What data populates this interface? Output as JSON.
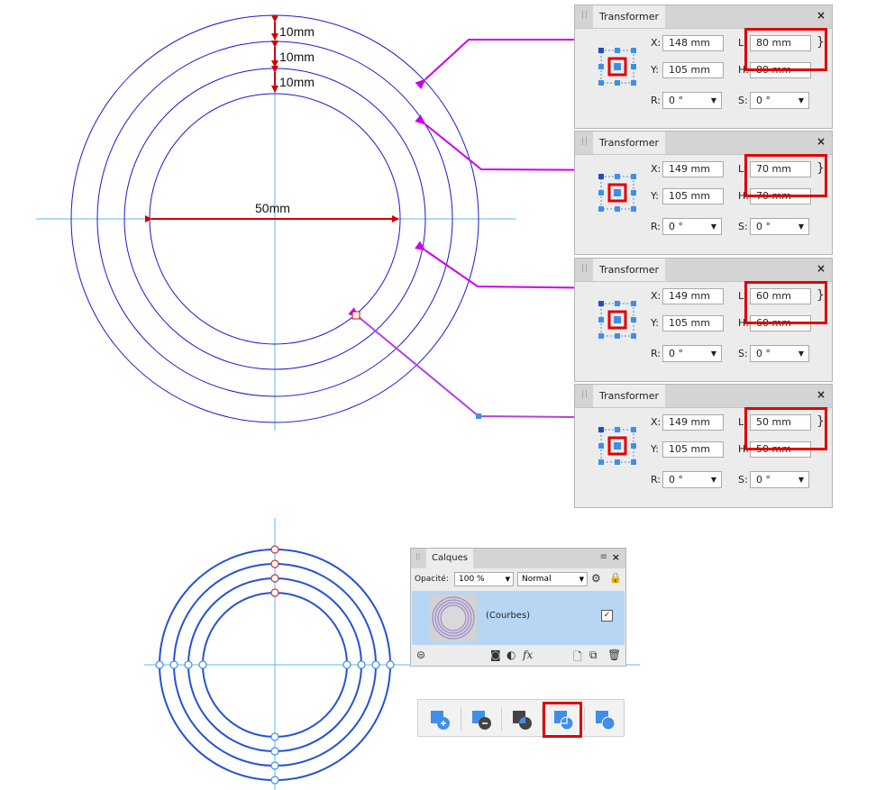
{
  "dimensions": {
    "ring_spacing": [
      "10mm",
      "10mm",
      "10mm"
    ],
    "inner_diameter": "50mm"
  },
  "transformer_panels": [
    {
      "title": "Transformer",
      "x_label": "X:",
      "x": "148 mm",
      "y_label": "Y:",
      "y": "105 mm",
      "l_label": "L:",
      "l": "80 mm",
      "h_label": "H:",
      "h": "80 mm",
      "r_label": "R:",
      "r": "0 °",
      "s_label": "S:",
      "s": "0 °"
    },
    {
      "title": "Transformer",
      "x_label": "X:",
      "x": "149 mm",
      "y_label": "Y:",
      "y": "105 mm",
      "l_label": "L:",
      "l": "70 mm",
      "h_label": "H:",
      "h": "70 mm",
      "r_label": "R:",
      "r": "0 °",
      "s_label": "S:",
      "s": "0 °"
    },
    {
      "title": "Transformer",
      "x_label": "X:",
      "x": "149 mm",
      "y_label": "Y:",
      "y": "105 mm",
      "l_label": "L:",
      "l": "60 mm",
      "h_label": "H:",
      "h": "60 mm",
      "r_label": "R:",
      "r": "0 °",
      "s_label": "S:",
      "s": "0 °"
    },
    {
      "title": "Transformer",
      "x_label": "X:",
      "x": "149 mm",
      "y_label": "Y:",
      "y": "105 mm",
      "l_label": "L:",
      "l": "50 mm",
      "h_label": "H:",
      "h": "50 mm",
      "r_label": "R:",
      "r": "0 °",
      "s_label": "S:",
      "s": "0 °"
    }
  ],
  "layers_panel": {
    "title": "Calques",
    "opacity_label": "Opacité:",
    "opacity_value": "100 %",
    "blend_mode": "Normal",
    "layer_name": "(Courbes)",
    "layer_visible": "✓"
  },
  "boolean_toolbar": {
    "buttons": [
      "add",
      "subtract",
      "intersect",
      "divide",
      "combine"
    ],
    "selected": "divide"
  },
  "colors": {
    "circle_stroke": "#1a1ad6",
    "guide": "#5bb8f5",
    "dimension": "#d40000",
    "callout": "#cc00ee",
    "highlight": "#e10000",
    "accent_blue": "#3f8fe8"
  },
  "icons": {
    "close": "×",
    "grip": "||",
    "dropdown": "▼",
    "link": "chain-link-icon"
  }
}
